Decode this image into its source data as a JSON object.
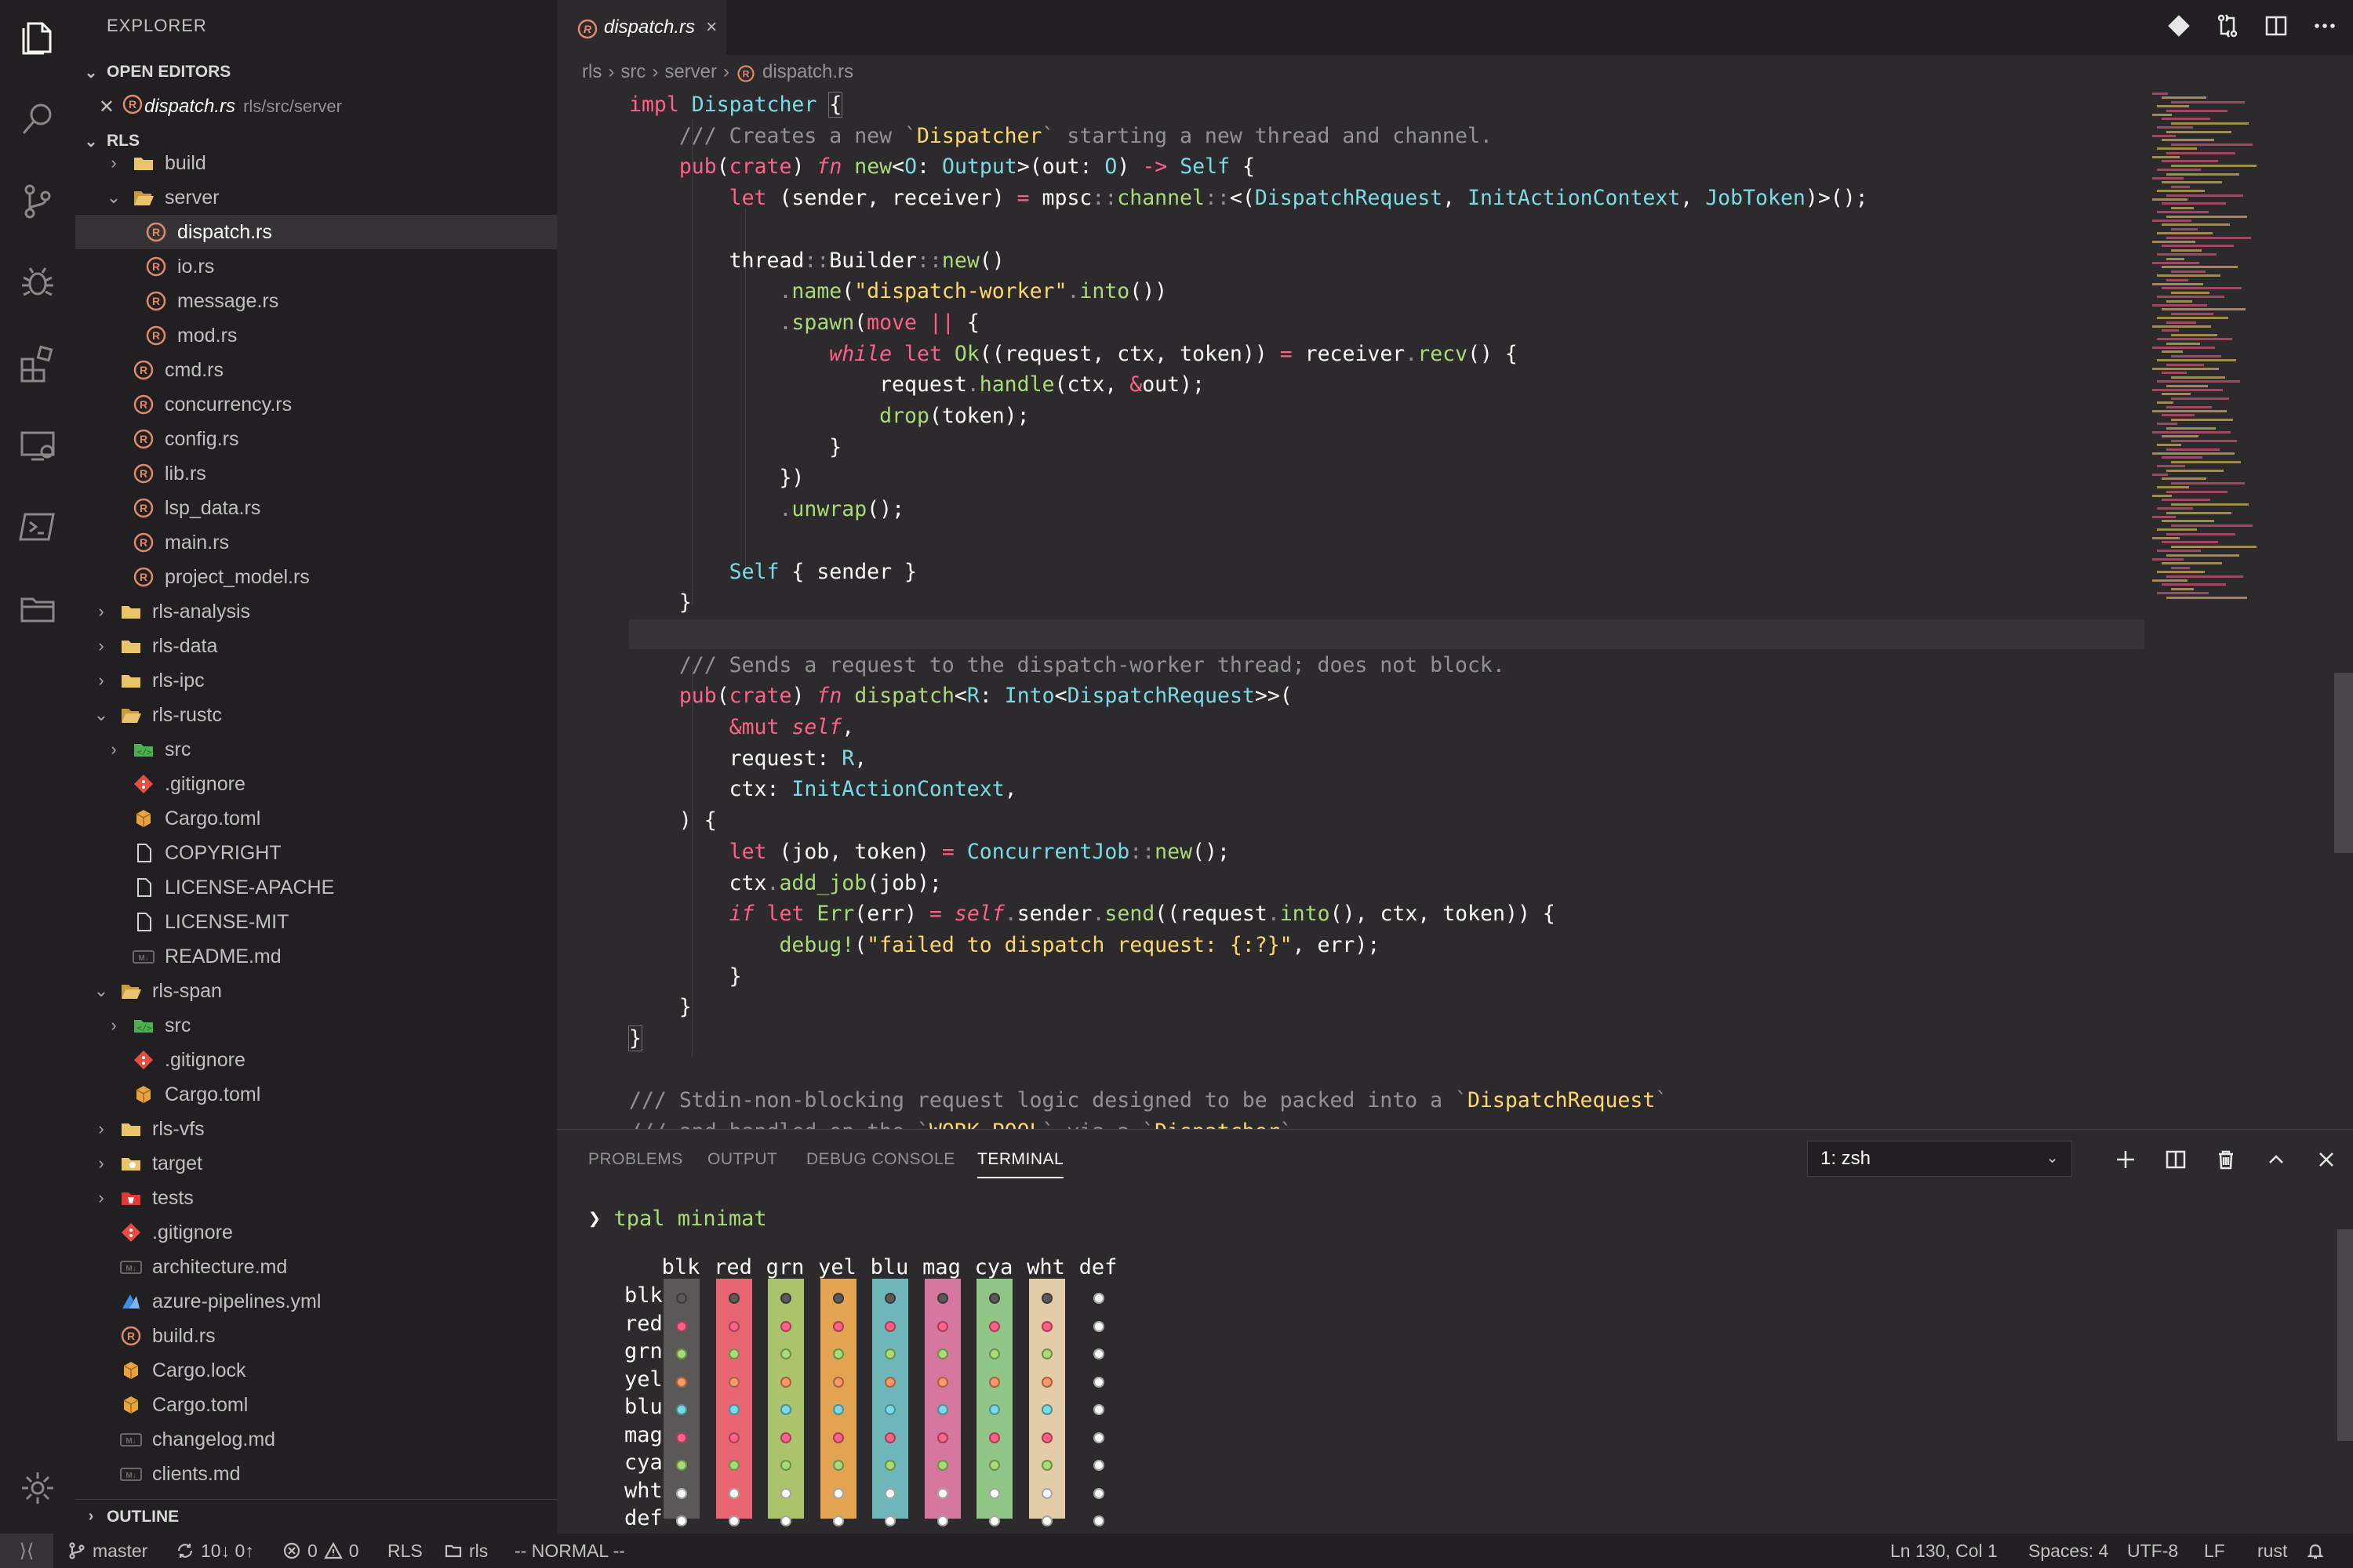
{
  "sidebar": {
    "title": "EXPLORER",
    "open_editors_label": "OPEN EDITORS",
    "open_editor_file": "dispatch.rs",
    "open_editor_path": "rls/src/server",
    "root_label": "RLS",
    "outline_label": "OUTLINE",
    "tree": [
      {
        "label": "build",
        "icon": "folder-icon",
        "indent": 1,
        "twisty": ">"
      },
      {
        "label": "server",
        "icon": "folder-open-icon",
        "indent": 1,
        "twisty": "v"
      },
      {
        "label": "dispatch.rs",
        "icon": "rust-file-icon",
        "indent": 2,
        "selected": true
      },
      {
        "label": "io.rs",
        "icon": "rust-file-icon",
        "indent": 2
      },
      {
        "label": "message.rs",
        "icon": "rust-file-icon",
        "indent": 2
      },
      {
        "label": "mod.rs",
        "icon": "rust-file-icon",
        "indent": 2
      },
      {
        "label": "cmd.rs",
        "icon": "rust-file-icon",
        "indent": 1
      },
      {
        "label": "concurrency.rs",
        "icon": "rust-file-icon",
        "indent": 1
      },
      {
        "label": "config.rs",
        "icon": "rust-file-icon",
        "indent": 1
      },
      {
        "label": "lib.rs",
        "icon": "rust-file-icon",
        "indent": 1
      },
      {
        "label": "lsp_data.rs",
        "icon": "rust-file-icon",
        "indent": 1
      },
      {
        "label": "main.rs",
        "icon": "rust-file-icon",
        "indent": 1
      },
      {
        "label": "project_model.rs",
        "icon": "rust-file-icon",
        "indent": 1
      },
      {
        "label": "rls-analysis",
        "icon": "folder-icon",
        "indent": 0,
        "twisty": ">"
      },
      {
        "label": "rls-data",
        "icon": "folder-icon",
        "indent": 0,
        "twisty": ">"
      },
      {
        "label": "rls-ipc",
        "icon": "folder-icon",
        "indent": 0,
        "twisty": ">"
      },
      {
        "label": "rls-rustc",
        "icon": "folder-open-icon",
        "indent": 0,
        "twisty": "v"
      },
      {
        "label": "src",
        "icon": "src-folder-icon",
        "indent": 1,
        "twisty": ">"
      },
      {
        "label": ".gitignore",
        "icon": "git-icon",
        "indent": 1
      },
      {
        "label": "Cargo.toml",
        "icon": "cargo-icon",
        "indent": 1
      },
      {
        "label": "COPYRIGHT",
        "icon": "file-icon",
        "indent": 1
      },
      {
        "label": "LICENSE-APACHE",
        "icon": "file-icon",
        "indent": 1
      },
      {
        "label": "LICENSE-MIT",
        "icon": "file-icon",
        "indent": 1
      },
      {
        "label": "README.md",
        "icon": "markdown-icon",
        "indent": 1
      },
      {
        "label": "rls-span",
        "icon": "folder-open-icon",
        "indent": 0,
        "twisty": "v"
      },
      {
        "label": "src",
        "icon": "src-folder-icon",
        "indent": 1,
        "twisty": ">"
      },
      {
        "label": ".gitignore",
        "icon": "git-icon",
        "indent": 1
      },
      {
        "label": "Cargo.toml",
        "icon": "cargo-icon",
        "indent": 1
      },
      {
        "label": "rls-vfs",
        "icon": "folder-icon",
        "indent": 0,
        "twisty": ">"
      },
      {
        "label": "target",
        "icon": "target-folder-icon",
        "indent": 0,
        "twisty": ">"
      },
      {
        "label": "tests",
        "icon": "tests-folder-icon",
        "indent": 0,
        "twisty": ">"
      },
      {
        "label": ".gitignore",
        "icon": "git-icon",
        "indent": 0
      },
      {
        "label": "architecture.md",
        "icon": "markdown-icon",
        "indent": 0
      },
      {
        "label": "azure-pipelines.yml",
        "icon": "azure-icon",
        "indent": 0
      },
      {
        "label": "build.rs",
        "icon": "rust-file-icon",
        "indent": 0
      },
      {
        "label": "Cargo.lock",
        "icon": "cargo-icon",
        "indent": 0
      },
      {
        "label": "Cargo.toml",
        "icon": "cargo-icon",
        "indent": 0
      },
      {
        "label": "changelog.md",
        "icon": "markdown-icon",
        "indent": 0
      },
      {
        "label": "clients.md",
        "icon": "markdown-icon",
        "indent": 0
      }
    ]
  },
  "editor": {
    "tab_label": "dispatch.rs",
    "tab_close": "×",
    "breadcrumb": [
      "rls",
      "src",
      "server",
      "dispatch.rs"
    ],
    "code_lines": [
      "<span class=\"kw\">impl</span> <span class=\"ty\">Dispatcher</span> <span class=\"brk\">{</span>",
      "    <span class=\"cm\">/// Creates a new `</span><span class=\"str\">Dispatcher</span><span class=\"cm\">` starting a new thread and channel.</span>",
      "    <span class=\"kw\">pub</span>(<span class=\"kw\">crate</span>) <span class=\"it\">fn</span> <span class=\"fn\">new</span>&lt;<span class=\"ty\">O</span>: <span class=\"ty\">Output</span>&gt;(out: <span class=\"ty\">O</span>) <span class=\"kw\">-&gt;</span> <span class=\"ty\">Self</span> {",
      "        <span class=\"kw\">let</span> (sender, receiver) <span class=\"kw\">=</span> mpsc<span class=\"pc\">::</span><span class=\"fn\">channel</span><span class=\"pc\">::</span>&lt;(<span class=\"ty\">DispatchRequest</span>, <span class=\"ty\">InitActionContext</span>, <span class=\"ty\">JobToken</span>)&gt;();",
      "",
      "        thread<span class=\"pc\">::</span>Builder<span class=\"pc\">::</span><span class=\"fn\">new</span>()",
      "            <span class=\"pc\">.</span><span class=\"fn\">name</span>(<span class=\"str\">\"dispatch-worker\"</span><span class=\"pc\">.</span><span class=\"fn\">into</span>())",
      "            <span class=\"pc\">.</span><span class=\"fn\">spawn</span>(<span class=\"kw\">move</span> <span class=\"kw\">||</span> {",
      "                <span class=\"it\">while</span> <span class=\"kw\">let</span> <span class=\"fn\">Ok</span>((request, ctx, token)) <span class=\"kw\">=</span> receiver<span class=\"pc\">.</span><span class=\"fn\">recv</span>() {",
      "                    request<span class=\"pc\">.</span><span class=\"fn\">handle</span>(ctx, <span class=\"kw\">&amp;</span>out);",
      "                    <span class=\"fn\">drop</span>(token);",
      "                }",
      "            })",
      "            <span class=\"pc\">.</span><span class=\"fn\">unwrap</span>();",
      "",
      "        <span class=\"ty\">Self</span> { sender }",
      "    }",
      "",
      "    <span class=\"cm\">/// Sends a request to the dispatch-worker thread; does not block.</span>",
      "    <span class=\"kw\">pub</span>(<span class=\"kw\">crate</span>) <span class=\"it\">fn</span> <span class=\"fn\">dispatch</span>&lt;<span class=\"ty\">R</span>: <span class=\"ty\">Into</span>&lt;<span class=\"ty\">DispatchRequest</span>&gt;&gt;(",
      "        <span class=\"kw\">&amp;mut</span> <span class=\"it\">self</span>,",
      "        request: <span class=\"ty\">R</span>,",
      "        ctx: <span class=\"ty\">InitActionContext</span>,",
      "    ) {",
      "        <span class=\"kw\">let</span> (job, token) <span class=\"kw\">=</span> <span class=\"ty\">ConcurrentJob</span><span class=\"pc\">::</span><span class=\"fn\">new</span>();",
      "        ctx<span class=\"pc\">.</span><span class=\"fn\">add_job</span>(job);",
      "        <span class=\"it\">if</span> <span class=\"kw\">let</span> <span class=\"fn\">Err</span>(err) <span class=\"kw\">=</span> <span class=\"it\">self</span><span class=\"pc\">.</span>sender<span class=\"pc\">.</span><span class=\"fn\">send</span>((request<span class=\"pc\">.</span><span class=\"fn\">into</span>(), ctx, token)) {",
      "            <span class=\"fn\">debug!</span>(<span class=\"str\">\"failed to dispatch request: {:?}\"</span>, err);",
      "        }",
      "    }",
      "<span class=\"brk\">}</span>",
      "",
      "<span class=\"cm\">/// Stdin-non-blocking request logic designed to be packed into a `</span><span class=\"str\">DispatchRequest</span><span class=\"cm\">`</span>",
      "<span class=\"cm\">/// and handled on the `</span><span class=\"str\">WORK_POOL</span><span class=\"cm\">` via a `</span><span class=\"str\">Dispatcher</span><span class=\"cm\">`.</span>"
    ]
  },
  "panel": {
    "tabs": [
      "PROBLEMS",
      "OUTPUT",
      "DEBUG CONSOLE",
      "TERMINAL"
    ],
    "active_tab": "TERMINAL",
    "terminal_select": "1: zsh",
    "prompt_symbol": "❯",
    "command": "tpal minimat",
    "color_labels": [
      "blk",
      "red",
      "grn",
      "yel",
      "blu",
      "mag",
      "cya",
      "wht",
      "def"
    ],
    "palette": [
      "#5b5858",
      "#ff6188",
      "#a9dc76",
      "#fc9867",
      "#78dce8",
      "#ff6188",
      "#a9dc76",
      "#fcfcfa",
      "#fcfcfa"
    ],
    "column_bg": [
      "#5b5858",
      "#e86571",
      "#a9c46b",
      "#e3a452",
      "#6fb6ba",
      "#d6779f",
      "#8fc686",
      "#e3cda8",
      "transparent"
    ],
    "dot_glyph": "☻"
  },
  "status": {
    "branch": "master",
    "sync": "10↓ 0↑",
    "errors": "0",
    "warnings": "0",
    "rls": "RLS",
    "folder": "rls",
    "mode": "-- NORMAL --",
    "position": "Ln 130, Col 1",
    "spaces": "Spaces: 4",
    "encoding": "UTF-8",
    "eol": "LF",
    "language": "rust"
  }
}
